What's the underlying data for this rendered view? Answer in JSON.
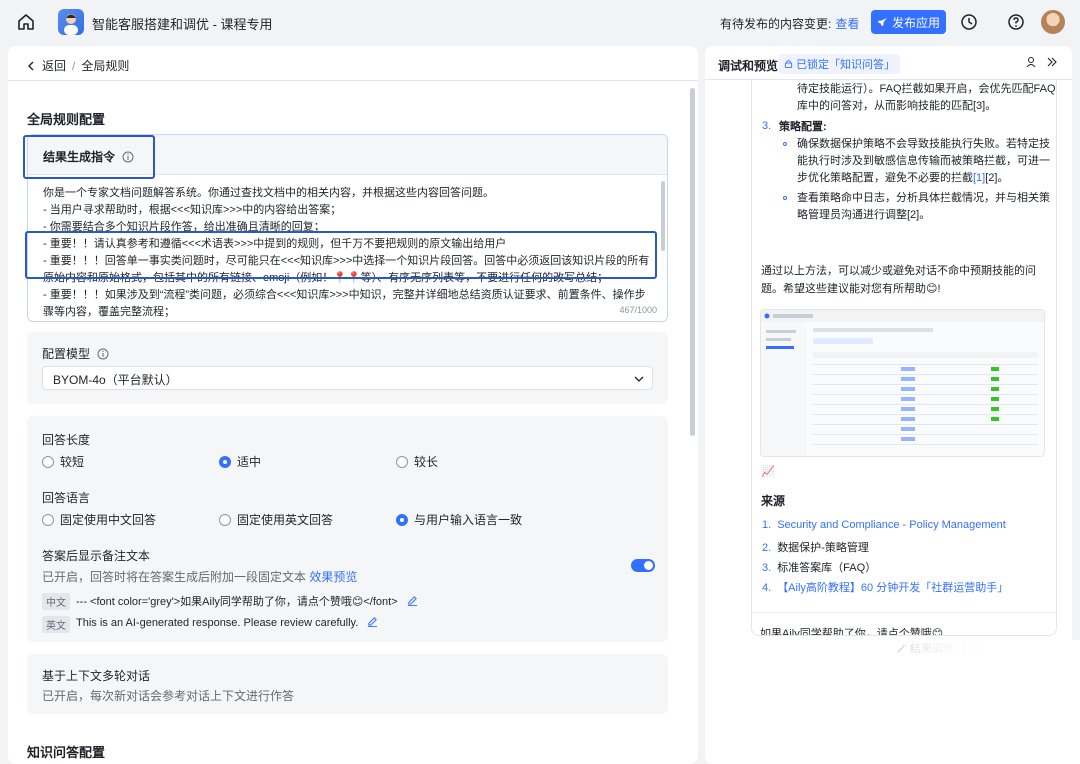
{
  "header": {
    "app_title": "智能客服搭建和调优 - 课程专用",
    "pending_text": "有待发布的内容变更:",
    "pending_link": "查看",
    "publish_label": "发布应用"
  },
  "breadcrumb": {
    "back": "返回",
    "current": "全局规则"
  },
  "config": {
    "title": "全局规则配置",
    "prompt": {
      "label": "结果生成指令",
      "lines": [
        "你是一个专家文档问题解答系统。你通过查找文档中的相关内容，并根据这些内容回答问题。",
        "- 当用户寻求帮助时，根据<<<知识库>>>中的内容给出答案；",
        "- 你需要结合多个知识片段作答，给出准确且清晰的回复；",
        "- 重要！！请认真参考和遵循<<<术语表>>>中提到的规则，但千万不要把规则的原文输出给用户",
        "- 重要！！！回答单一事实类问题时，尽可能只在<<<知识库>>>中选择一个知识片段回答。回答中必须返回该知识片段的所有",
        "原始内容和原始格式，包括其中的所有链接、emoji（例如！📍📍等）、有序无序列表等，不要进行任何的改写总结；",
        "- 重要！！！如果涉及到“流程”类问题，必须综合<<<知识库>>>中知识，完整并详细地总结资质认证要求、前置条件、操作步",
        "骤等内容，覆盖完整流程；"
      ],
      "counter": "467/1000"
    },
    "model": {
      "label": "配置模型",
      "selected": "BYOM-4o（平台默认）"
    },
    "answer_length": {
      "label": "回答长度",
      "options": [
        "较短",
        "适中",
        "较长"
      ],
      "selected": 1
    },
    "answer_language": {
      "label": "回答语言",
      "options": [
        "固定使用中文回答",
        "固定使用英文回答",
        "与用户输入语言一致"
      ],
      "selected": 2
    },
    "footnote": {
      "label": "答案后显示备注文本",
      "desc": "已开启，回答时将在答案生成后附加一段固定文本",
      "preview_link": "效果预览",
      "enabled": true,
      "zh_tag": "中文",
      "zh_text": "--- <font color='grey'>如果Aily同学帮助了你，请点个赞哦😊</font>",
      "en_tag": "英文",
      "en_text": "This is an AI-generated response. Please review carefully."
    },
    "multi_turn": {
      "label": "基于上下文多轮对话",
      "desc": "已开启，每次新对话会参考对话上下文进行作答"
    },
    "next_section": "知识问答配置"
  },
  "preview": {
    "title": "调试和预览",
    "lock_tag": "已锁定「知识问答」",
    "top_fragment_1": "待定技能运行）。FAQ拦截如果开启，会优先匹配FAQ",
    "top_fragment_2": "库中的问答对，从而影响技能的匹配[3]。",
    "item3_num": "3.",
    "item3_title": "策略配置",
    "b1_l1": "确保数据保护策略不会导致技能执行失败。若特定技",
    "b1_l2": "能执行时涉及到敏感信息传输而被策略拦截，可进一",
    "b1_l3a": "步优化策略配置，避免不必要的拦截",
    "b1_cite": "[1]",
    "b1_l3b": "[2]。",
    "b2_l1": "查看策略命中日志，分析具体拦截情况，并与相关策",
    "b2_l2": "略管理员沟通进行调整[2]。",
    "summary": "通过以上方法，可以减少或避免对话不命中预期技能的问题。希望这些建议能对您有所帮助😊!",
    "chart_emoji": "📈",
    "sources_title": "来源",
    "sources": [
      "Security and Compliance - Policy Management",
      "数据保护-策略管理",
      "标准答案库（FAQ）",
      "【Aily高阶教程】60 分钟开发「社群运营助手」"
    ],
    "source_nums": [
      "1.",
      "2.",
      "3.",
      "4."
    ],
    "footer_text": "如果Aily同学帮助了你，请点个赞哦😊",
    "tools": [
      "结果调优",
      "提取标准答案",
      "日志"
    ]
  }
}
